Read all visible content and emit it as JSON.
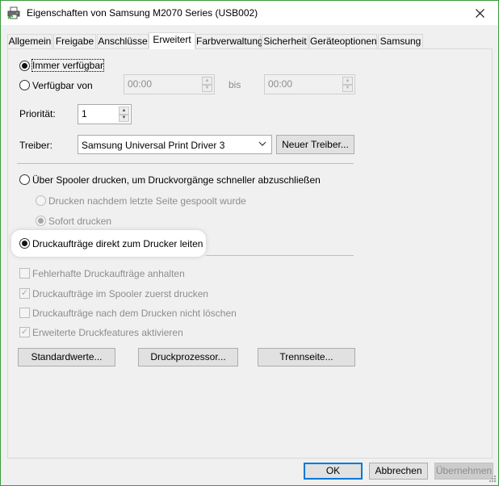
{
  "window": {
    "title": "Eigenschaften von Samsung M2070 Series (USB002)"
  },
  "tabs": [
    {
      "label": "Allgemein"
    },
    {
      "label": "Freigabe"
    },
    {
      "label": "Anschlüsse"
    },
    {
      "label": "Erweitert",
      "active": true
    },
    {
      "label": "Farbverwaltung"
    },
    {
      "label": "Sicherheit"
    },
    {
      "label": "Geräteoptionen"
    },
    {
      "label": "Samsung"
    }
  ],
  "availability": {
    "always_label": "Immer verfügbar",
    "always_selected": true,
    "from_label": "Verfügbar von",
    "from_value": "00:00",
    "to_label": "bis",
    "to_value": "00:00"
  },
  "priority": {
    "label": "Priorität:",
    "value": "1"
  },
  "driver": {
    "label": "Treiber:",
    "selected": "Samsung Universal Print Driver 3",
    "new_button": "Neuer Treiber..."
  },
  "spooling": {
    "spool_label": "Über Spooler drucken, um Druckvorgänge schneller abzuschließen",
    "after_last_page_label": "Drucken nachdem letzte Seite gespoolt wurde",
    "immediately_label": "Sofort drucken",
    "direct_label": "Druckaufträge direkt zum Drucker leiten",
    "direct_selected": true
  },
  "options": [
    {
      "label": "Fehlerhafte Druckaufträge anhalten",
      "checked": false
    },
    {
      "label": "Druckaufträge im Spooler zuerst drucken",
      "checked": true
    },
    {
      "label": "Druckaufträge nach dem Drucken nicht löschen",
      "checked": false
    },
    {
      "label": "Erweiterte Druckfeatures aktivieren",
      "checked": true
    }
  ],
  "action_buttons": {
    "defaults": "Standardwerte...",
    "processor": "Druckprozessor...",
    "separator": "Trennseite..."
  },
  "footer": {
    "ok": "OK",
    "cancel": "Abbrechen",
    "apply": "Übernehmen"
  }
}
